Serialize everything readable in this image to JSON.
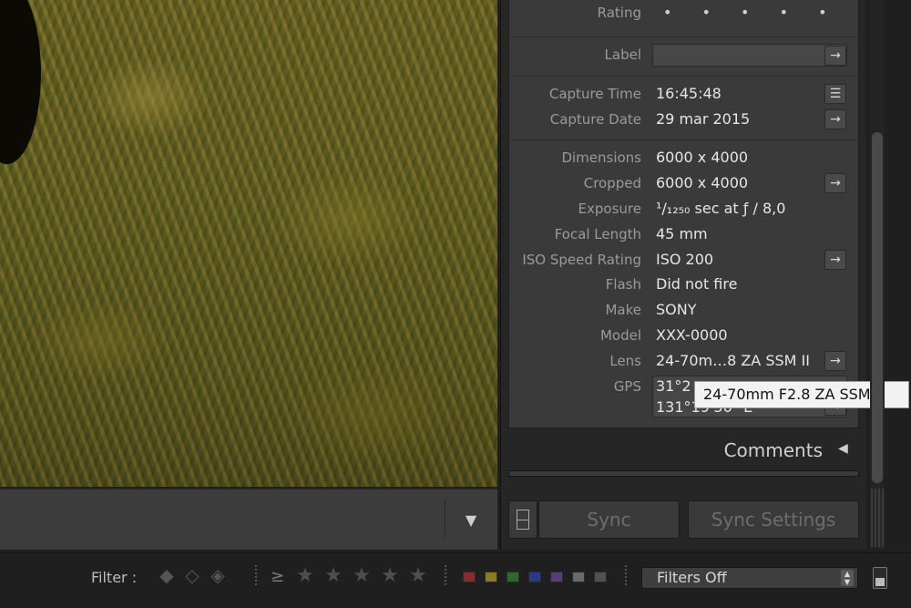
{
  "metadata": {
    "rating": {
      "label": "Rating",
      "dots": "• • • • •"
    },
    "label_field": {
      "label": "Label",
      "value": ""
    },
    "capture_time": {
      "label": "Capture Time",
      "value": "16:45:48"
    },
    "capture_date": {
      "label": "Capture Date",
      "value": "29 mar 2015"
    },
    "dimensions": {
      "label": "Dimensions",
      "value": "6000 x 4000"
    },
    "cropped": {
      "label": "Cropped",
      "value": "6000 x 4000"
    },
    "exposure": {
      "label": "Exposure",
      "value": "¹/₁₂₅₀ sec at ƒ / 8,0"
    },
    "focal_length": {
      "label": "Focal Length",
      "value": "45 mm"
    },
    "iso": {
      "label": "ISO Speed Rating",
      "value": "ISO 200"
    },
    "flash": {
      "label": "Flash",
      "value": "Did not fire"
    },
    "make": {
      "label": "Make",
      "value": "SONY"
    },
    "model": {
      "label": "Model",
      "value": "XXX-0000"
    },
    "lens": {
      "label": "Lens",
      "value": "24-70m…8 ZA SSM II"
    },
    "gps": {
      "label": "GPS",
      "line1": "31°2",
      "line2": "131°19'36\" E"
    }
  },
  "tooltip": {
    "text": "24-70mm F2.8 ZA SSM II"
  },
  "comments": {
    "title": "Comments"
  },
  "sync": {
    "sync_label": "Sync",
    "sync_settings_label": "Sync Settings"
  },
  "filterbar": {
    "filter_label": "Filter :",
    "gte_symbol": "≥",
    "star_glyph": "★",
    "flag_icons": [
      "pick-flag-icon",
      "unflagged-icon",
      "reject-flag-icon"
    ],
    "color_labels": [
      "#8a2a2a",
      "#8a7a20",
      "#2a6a2a",
      "#2a3a8a",
      "#5a3a7a",
      "#6a6a6a",
      "#505050"
    ],
    "filters_select": "Filters Off"
  },
  "colors": {
    "panel_bg": "#3a3a3a",
    "accent_text": "#e6e6e6"
  }
}
